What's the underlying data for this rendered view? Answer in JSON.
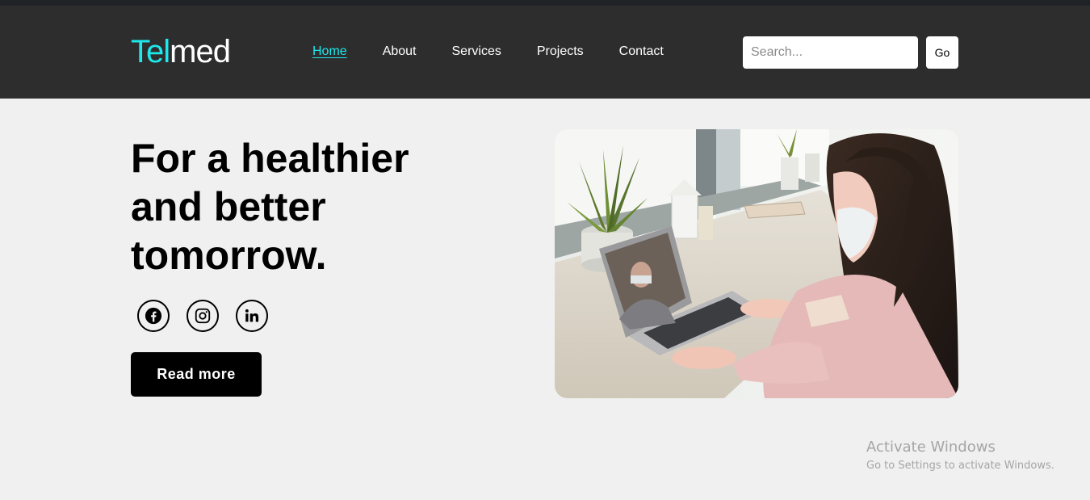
{
  "brand": {
    "logo_accent": "Tel",
    "logo_rest": "med",
    "accent_color": "#1ee8ec"
  },
  "nav": {
    "items": [
      {
        "label": "Home",
        "active": true
      },
      {
        "label": "About",
        "active": false
      },
      {
        "label": "Services",
        "active": false
      },
      {
        "label": "Projects",
        "active": false
      },
      {
        "label": "Contact",
        "active": false
      }
    ]
  },
  "search": {
    "placeholder": "Search...",
    "value": "",
    "button_label": "Go"
  },
  "hero": {
    "title": "For a healthier\nand better\ntomorrow.",
    "social_icons": [
      "facebook-icon",
      "instagram-icon",
      "linkedin-icon"
    ],
    "cta_label": "Read more",
    "image_description_icon": "telemedicine-photo"
  },
  "watermark": {
    "title": "Activate Windows",
    "subtitle": "Go to Settings to activate Windows."
  }
}
